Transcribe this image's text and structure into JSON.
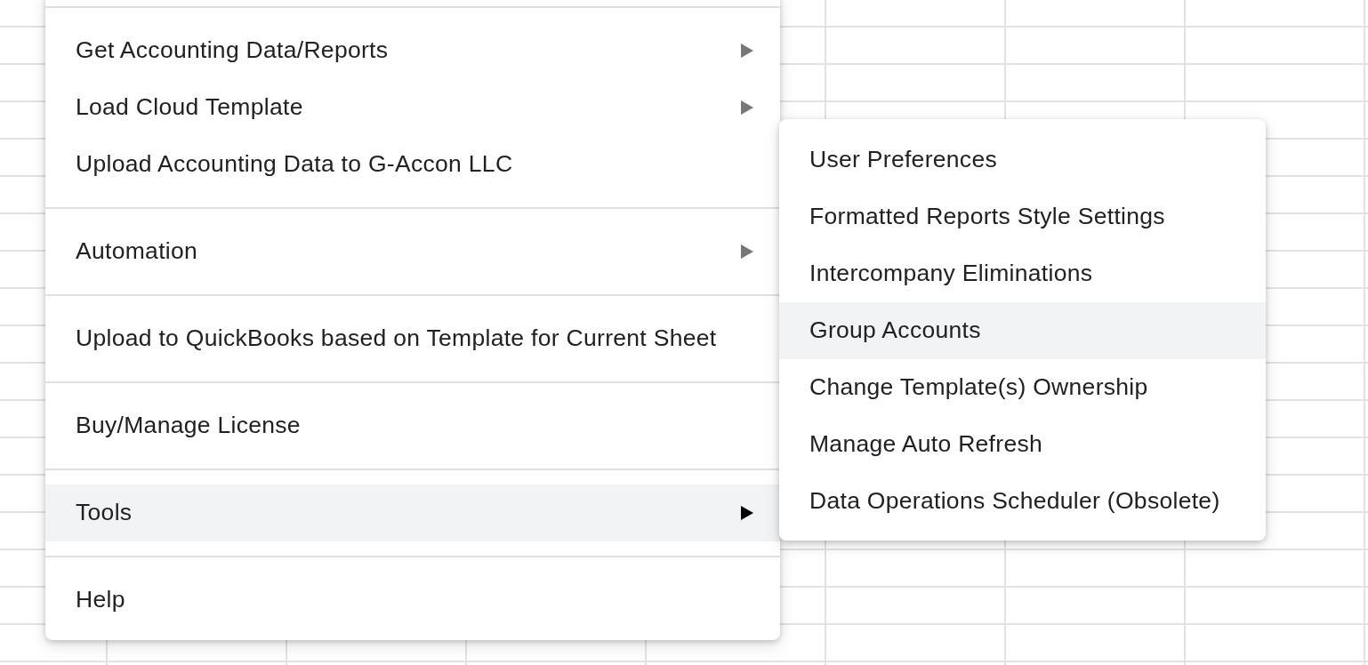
{
  "menu": {
    "items": [
      {
        "kind": "separator"
      },
      {
        "kind": "item",
        "label": "Get Accounting Data/Reports",
        "has_submenu": true,
        "selected": false
      },
      {
        "kind": "item",
        "label": "Load Cloud Template",
        "has_submenu": true,
        "selected": false
      },
      {
        "kind": "item",
        "label": "Upload Accounting Data to G-Accon LLC",
        "has_submenu": false,
        "selected": false
      },
      {
        "kind": "separator"
      },
      {
        "kind": "item",
        "label": "Automation",
        "has_submenu": true,
        "selected": false
      },
      {
        "kind": "separator"
      },
      {
        "kind": "item",
        "label": "Upload to QuickBooks based on Template for Current Sheet",
        "has_submenu": false,
        "selected": false
      },
      {
        "kind": "separator"
      },
      {
        "kind": "item",
        "label": "Buy/Manage License",
        "has_submenu": false,
        "selected": false
      },
      {
        "kind": "separator"
      },
      {
        "kind": "item",
        "label": "Tools",
        "has_submenu": true,
        "selected": true
      },
      {
        "kind": "separator"
      },
      {
        "kind": "item",
        "label": "Help",
        "has_submenu": false,
        "selected": false
      }
    ]
  },
  "submenu": {
    "items": [
      {
        "label": "User Preferences",
        "selected": false
      },
      {
        "label": "Formatted Reports Style Settings",
        "selected": false
      },
      {
        "label": "Intercompany Eliminations",
        "selected": false
      },
      {
        "label": "Group Accounts",
        "selected": true
      },
      {
        "label": "Change Template(s) Ownership",
        "selected": false
      },
      {
        "label": "Manage Auto Refresh",
        "selected": false
      },
      {
        "label": "Data Operations Scheduler (Obsolete)",
        "selected": false
      }
    ]
  }
}
